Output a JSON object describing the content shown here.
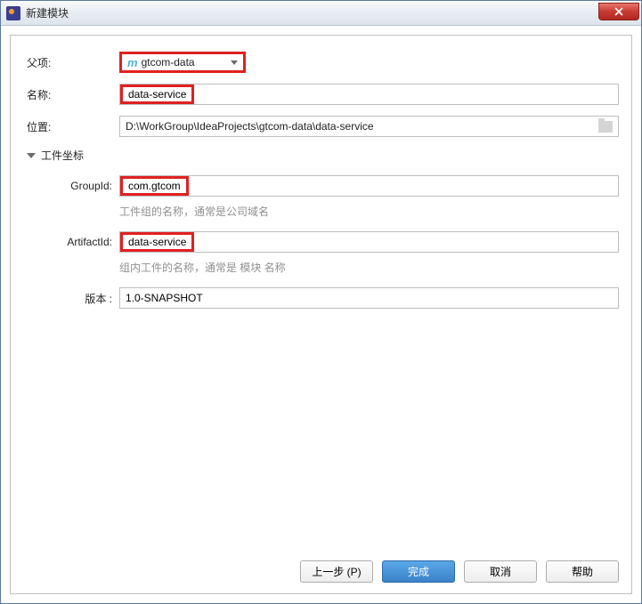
{
  "window": {
    "title": "新建模块"
  },
  "labels": {
    "parent": "父项:",
    "name": "名称:",
    "location": "位置:",
    "coordinates_section": "工件坐标",
    "groupId": "GroupId:",
    "artifactId": "ArtifactId:",
    "version": "版本 :"
  },
  "values": {
    "parent": "gtcom-data",
    "name": "data-service",
    "location": "D:\\WorkGroup\\IdeaProjects\\gtcom-data\\data-service",
    "groupId": "com.gtcom",
    "artifactId": "data-service",
    "version": "1.0-SNAPSHOT"
  },
  "hints": {
    "groupId": "工件组的名称，通常是公司域名",
    "artifactId": "组内工件的名称，通常是 模块 名称"
  },
  "buttons": {
    "previous": "上一步 (P)",
    "finish": "完成",
    "cancel": "取消",
    "help": "帮助"
  }
}
